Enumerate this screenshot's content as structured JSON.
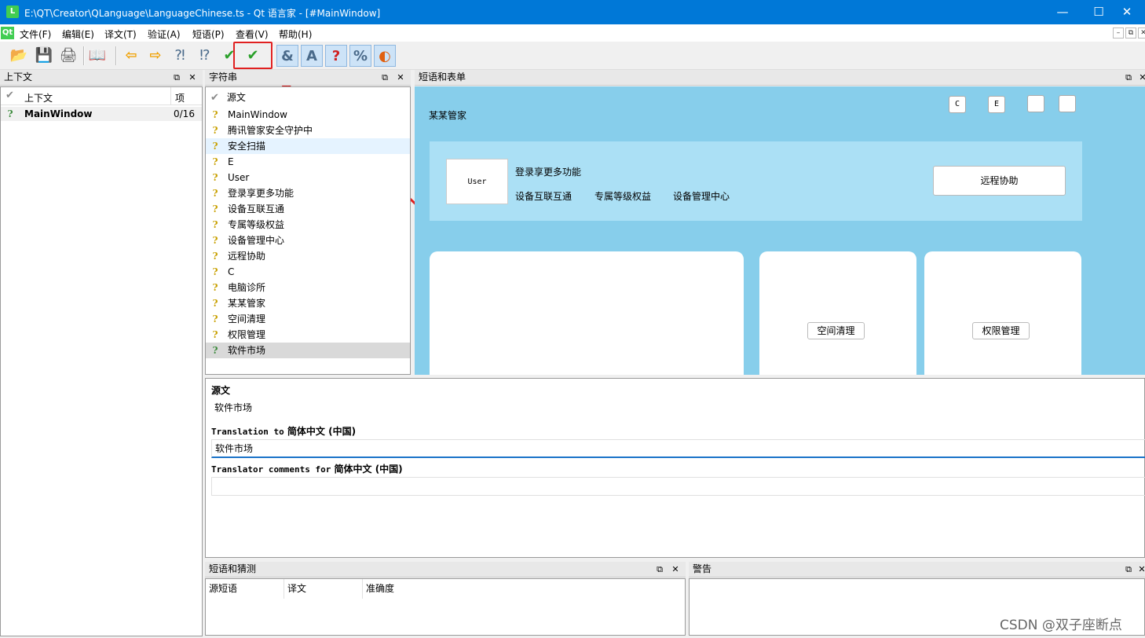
{
  "window": {
    "app_icon": "L",
    "title": "E:\\QT\\Creator\\QLanguage\\LanguageChinese.ts - Qt 语言家 - [#MainWindow]",
    "minimize": "—",
    "maximize": "☐",
    "close": "✕"
  },
  "menubar": {
    "logo": "Qt",
    "items": [
      "文件(F)",
      "编辑(E)",
      "译文(T)",
      "验证(A)",
      "短语(P)",
      "查看(V)",
      "帮助(H)"
    ],
    "mdi": [
      "–",
      "⧉",
      "✕"
    ]
  },
  "toolbar": {
    "buttons": [
      {
        "name": "open-icon",
        "glyph": "📂"
      },
      {
        "name": "save-icon",
        "glyph": "💾"
      },
      {
        "name": "print-icon",
        "glyph": "🖨"
      },
      {
        "name": "phrasebook-icon",
        "glyph": "📖"
      },
      {
        "name": "prev-icon",
        "glyph": "⇦"
      },
      {
        "name": "next-icon",
        "glyph": "⇨"
      },
      {
        "name": "prev-unfinished-icon",
        "glyph": "⁈"
      },
      {
        "name": "next-unfinished-icon",
        "glyph": "⁉"
      },
      {
        "name": "done-icon",
        "glyph": "✔"
      },
      {
        "name": "done-next-icon",
        "glyph": "✔"
      },
      {
        "name": "accelerators-icon",
        "glyph": "&"
      },
      {
        "name": "punctuation-icon",
        "glyph": "A"
      },
      {
        "name": "phrase-matches-icon",
        "glyph": "?"
      },
      {
        "name": "place-markers-icon",
        "glyph": "%"
      },
      {
        "name": "length-icon",
        "glyph": "◐"
      }
    ]
  },
  "context_dock": {
    "title": "上下文",
    "float": "⧉",
    "close": "✕",
    "columns": [
      "上下文",
      "项"
    ],
    "rows": [
      {
        "context": "MainWindow",
        "items": "0/16"
      }
    ]
  },
  "strings_dock": {
    "title": "字符串",
    "float": "⧉",
    "close": "✕",
    "header": "源文",
    "rows": [
      {
        "text": "MainWindow",
        "state": "unfinished"
      },
      {
        "text": "腾讯管家安全守护中",
        "state": "unfinished"
      },
      {
        "text": "安全扫描",
        "state": "unfinished"
      },
      {
        "text": "E",
        "state": "unfinished"
      },
      {
        "text": "User",
        "state": "unfinished"
      },
      {
        "text": "登录享更多功能",
        "state": "unfinished"
      },
      {
        "text": "设备互联互通",
        "state": "unfinished"
      },
      {
        "text": "专属等级权益",
        "state": "unfinished"
      },
      {
        "text": "设备管理中心",
        "state": "unfinished"
      },
      {
        "text": "远程协助",
        "state": "unfinished"
      },
      {
        "text": "C",
        "state": "unfinished"
      },
      {
        "text": "电脑诊所",
        "state": "unfinished"
      },
      {
        "text": "某某管家",
        "state": "unfinished"
      },
      {
        "text": "空间清理",
        "state": "unfinished"
      },
      {
        "text": "权限管理",
        "state": "unfinished"
      },
      {
        "text": "软件市场",
        "state": "finished"
      }
    ]
  },
  "forms_dock": {
    "title": "短语和表单",
    "float": "⧉",
    "close": "✕",
    "preview": {
      "brand": "某某管家",
      "btn_c": "C",
      "btn_e": "E",
      "user": "User",
      "login": "登录享更多功能",
      "feature1": "设备互联互通",
      "feature2": "专属等级权益",
      "feature3": "设备管理中心",
      "remote": "远程协助",
      "space_clean": "空间清理",
      "permission": "权限管理"
    }
  },
  "editor": {
    "source_label": "源文",
    "source_text": "软件市场",
    "translation_prefix": "Translation to",
    "translation_lang": "简体中文 (中国)",
    "translation_value": "软件市场",
    "comments_prefix": "Translator comments for",
    "comments_lang": "简体中文 (中国)",
    "comments_value": ""
  },
  "phrases_dock": {
    "title": "短语和猜测",
    "float": "⧉",
    "close": "✕",
    "columns": [
      "源短语",
      "译文",
      "准确度"
    ]
  },
  "warnings_dock": {
    "title": "警告",
    "float": "⧉",
    "close": "✕"
  },
  "watermark": "CSDN @双子座断点"
}
